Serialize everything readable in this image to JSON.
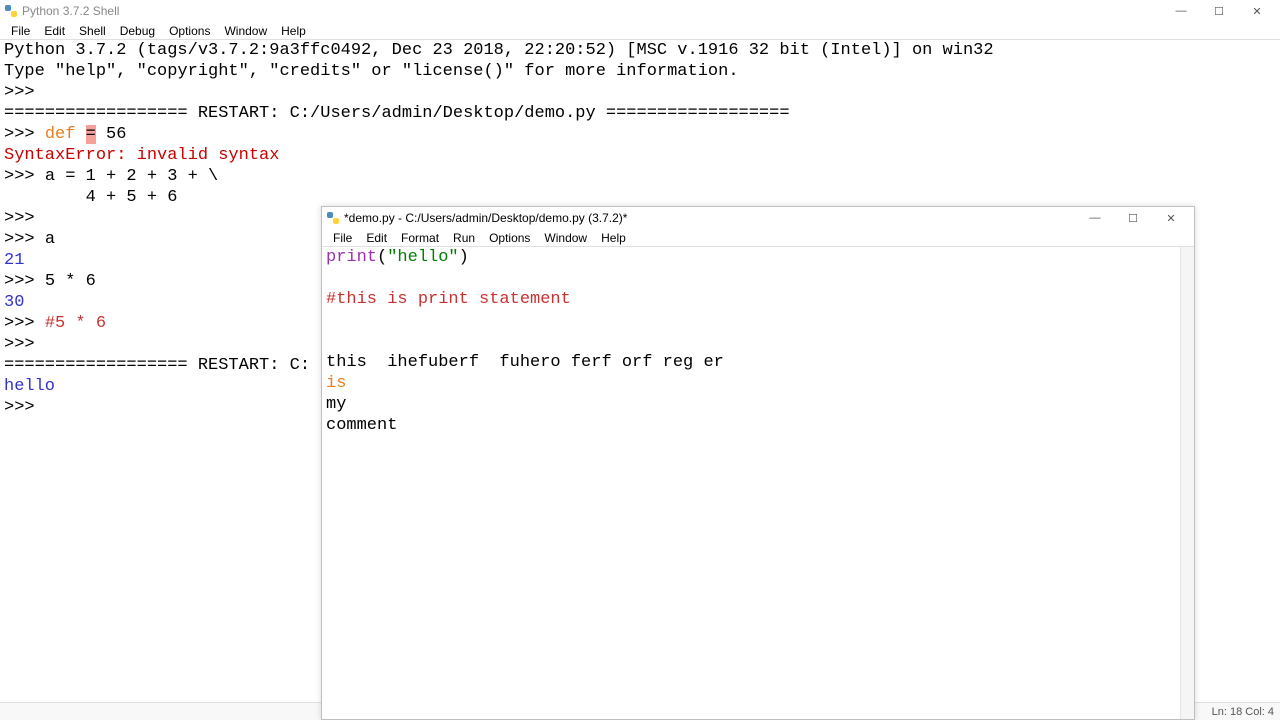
{
  "shell": {
    "title": "Python 3.7.2 Shell",
    "menu": [
      "File",
      "Edit",
      "Shell",
      "Debug",
      "Options",
      "Window",
      "Help"
    ],
    "banner_line1": "Python 3.7.2 (tags/v3.7.2:9a3ffc0492, Dec 23 2018, 22:20:52) [MSC v.1916 32 bit (Intel)] on win32",
    "banner_line2": "Type \"help\", \"copyright\", \"credits\" or \"license()\" for more information.",
    "prompt": ">>>",
    "restart1": "================== RESTART: C:/Users/admin/Desktop/demo.py ==================",
    "line_def_kw": "def",
    "line_def_err": "=",
    "line_def_rest": " 56",
    "syntax_error": "SyntaxError: invalid syntax",
    "line_a1": "a = 1 + 2 + 3 + \\",
    "line_a2": "    4 + 5 + 6",
    "line_a": "a",
    "out_21": "21",
    "line_56": "5 * 6",
    "out_30": "30",
    "line_comment": "#5 * 6",
    "restart2": "================== RESTART: C:",
    "out_hello": "hello",
    "status": "Ln: 18  Col: 4"
  },
  "editor": {
    "title": "*demo.py - C:/Users/admin/Desktop/demo.py (3.7.2)*",
    "menu": [
      "File",
      "Edit",
      "Format",
      "Run",
      "Options",
      "Window",
      "Help"
    ],
    "code_print_fn": "print",
    "code_print_open": "(",
    "code_print_str": "\"hello\"",
    "code_print_close": ")",
    "code_comment": "#this is print statement",
    "code_line_this": "this  ihefuberf  fuhero ferf orf reg er",
    "code_line_is": "is",
    "code_line_my": "my",
    "code_line_comment": "comment"
  }
}
